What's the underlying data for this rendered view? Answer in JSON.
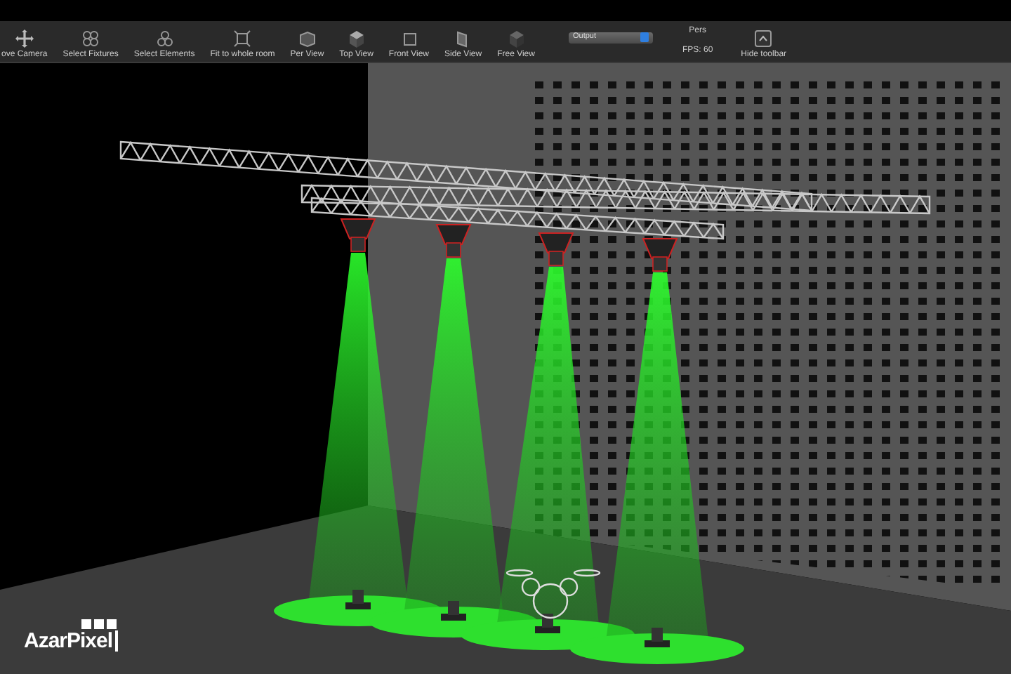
{
  "toolbar": {
    "items": [
      {
        "kind": "button",
        "label": "ove Camera"
      },
      {
        "kind": "button",
        "label": "Select Fixtures"
      },
      {
        "kind": "button",
        "label": "Select Elements"
      },
      {
        "kind": "button",
        "label": "Fit to whole room"
      },
      {
        "kind": "button",
        "label": "Per View"
      },
      {
        "kind": "button",
        "label": "Top View"
      },
      {
        "kind": "button",
        "label": "Front View"
      },
      {
        "kind": "button",
        "label": "Side View"
      },
      {
        "kind": "button",
        "label": "Free View"
      },
      {
        "kind": "dropdown",
        "value": "Output"
      },
      {
        "kind": "status",
        "lines": [
          "Pers",
          "FPS: 60"
        ]
      },
      {
        "kind": "button",
        "label": "Hide toolbar"
      }
    ]
  },
  "logo": {
    "text": "AzarPixel"
  }
}
